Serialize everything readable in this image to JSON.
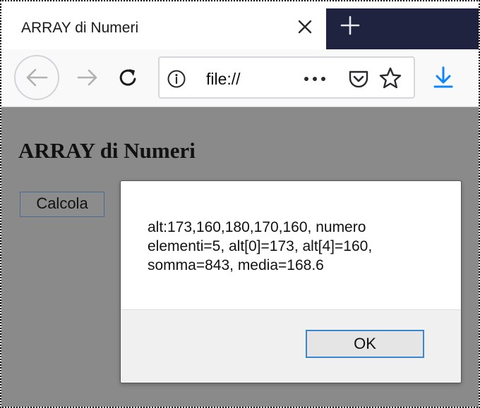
{
  "browser": {
    "tab_title": "ARRAY di Numeri",
    "url": "file://"
  },
  "page": {
    "title": "ARRAY di Numeri",
    "calc_button_label": "Calcola"
  },
  "dialog": {
    "message": "alt:173,160,180,170,160, numero elementi=5, alt[0]=173, alt[4]=160, somma=843, media=168.6",
    "ok_label": "OK"
  },
  "colors": {
    "page_background": "#8a8a8a",
    "tab_strip_dark": "#202340",
    "accent_blue": "#0a84ff"
  }
}
